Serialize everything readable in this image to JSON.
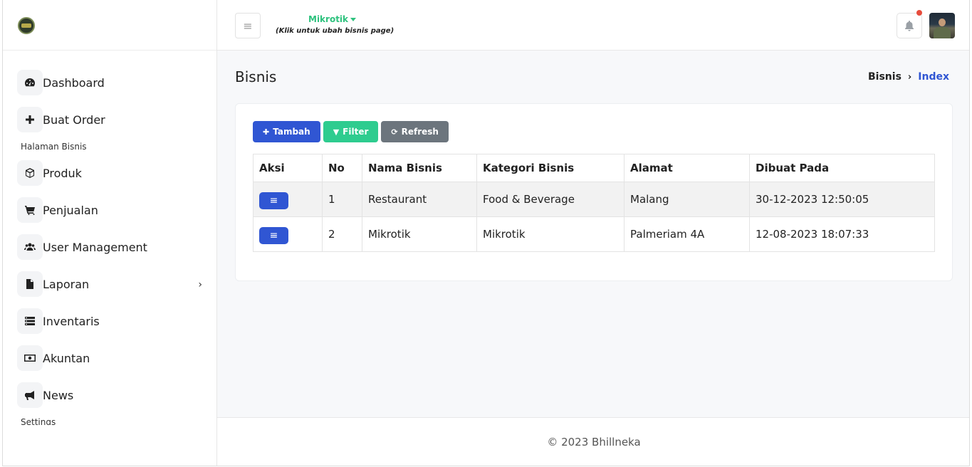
{
  "header": {
    "business_name": "Mikrotik",
    "business_hint": "(Klik untuk ubah bisnis page)"
  },
  "sidebar": {
    "items": [
      {
        "label": "Dashboard",
        "icon": "dashboard-icon"
      },
      {
        "label": "Buat Order",
        "icon": "plus-icon"
      },
      {
        "section": "Halaman Bisnis"
      },
      {
        "label": "Produk",
        "icon": "box-icon"
      },
      {
        "label": "Penjualan",
        "icon": "cart-icon"
      },
      {
        "label": "User Management",
        "icon": "users-icon"
      },
      {
        "label": "Laporan",
        "icon": "file-icon",
        "has_submenu": true
      },
      {
        "label": "Inventaris",
        "icon": "list-icon"
      },
      {
        "label": "Akuntan",
        "icon": "money-icon"
      },
      {
        "label": "News",
        "icon": "megaphone-icon"
      },
      {
        "section": "Settings"
      }
    ]
  },
  "page": {
    "title": "Bisnis",
    "breadcrumb_parent": "Bisnis",
    "breadcrumb_current": "Index"
  },
  "toolbar": {
    "add_label": "Tambah",
    "filter_label": "Filter",
    "refresh_label": "Refresh"
  },
  "table": {
    "columns": [
      "Aksi",
      "No",
      "Nama Bisnis",
      "Kategori Bisnis",
      "Alamat",
      "Dibuat Pada"
    ],
    "rows": [
      {
        "no": "1",
        "name": "Restaurant",
        "category": "Food & Beverage",
        "address": "Malang",
        "created": "30-12-2023 12:50:05"
      },
      {
        "no": "2",
        "name": "Mikrotik",
        "category": "Mikrotik",
        "address": "Palmeriam 4A",
        "created": "12-08-2023 18:07:33"
      }
    ]
  },
  "footer": {
    "text": "© 2023 Bhillneka"
  },
  "colors": {
    "primary": "#3056d3",
    "success": "#2ecc8f",
    "secondary": "#6c757d",
    "accent_green": "#2ec27e",
    "notification_dot": "#e74c3c"
  }
}
